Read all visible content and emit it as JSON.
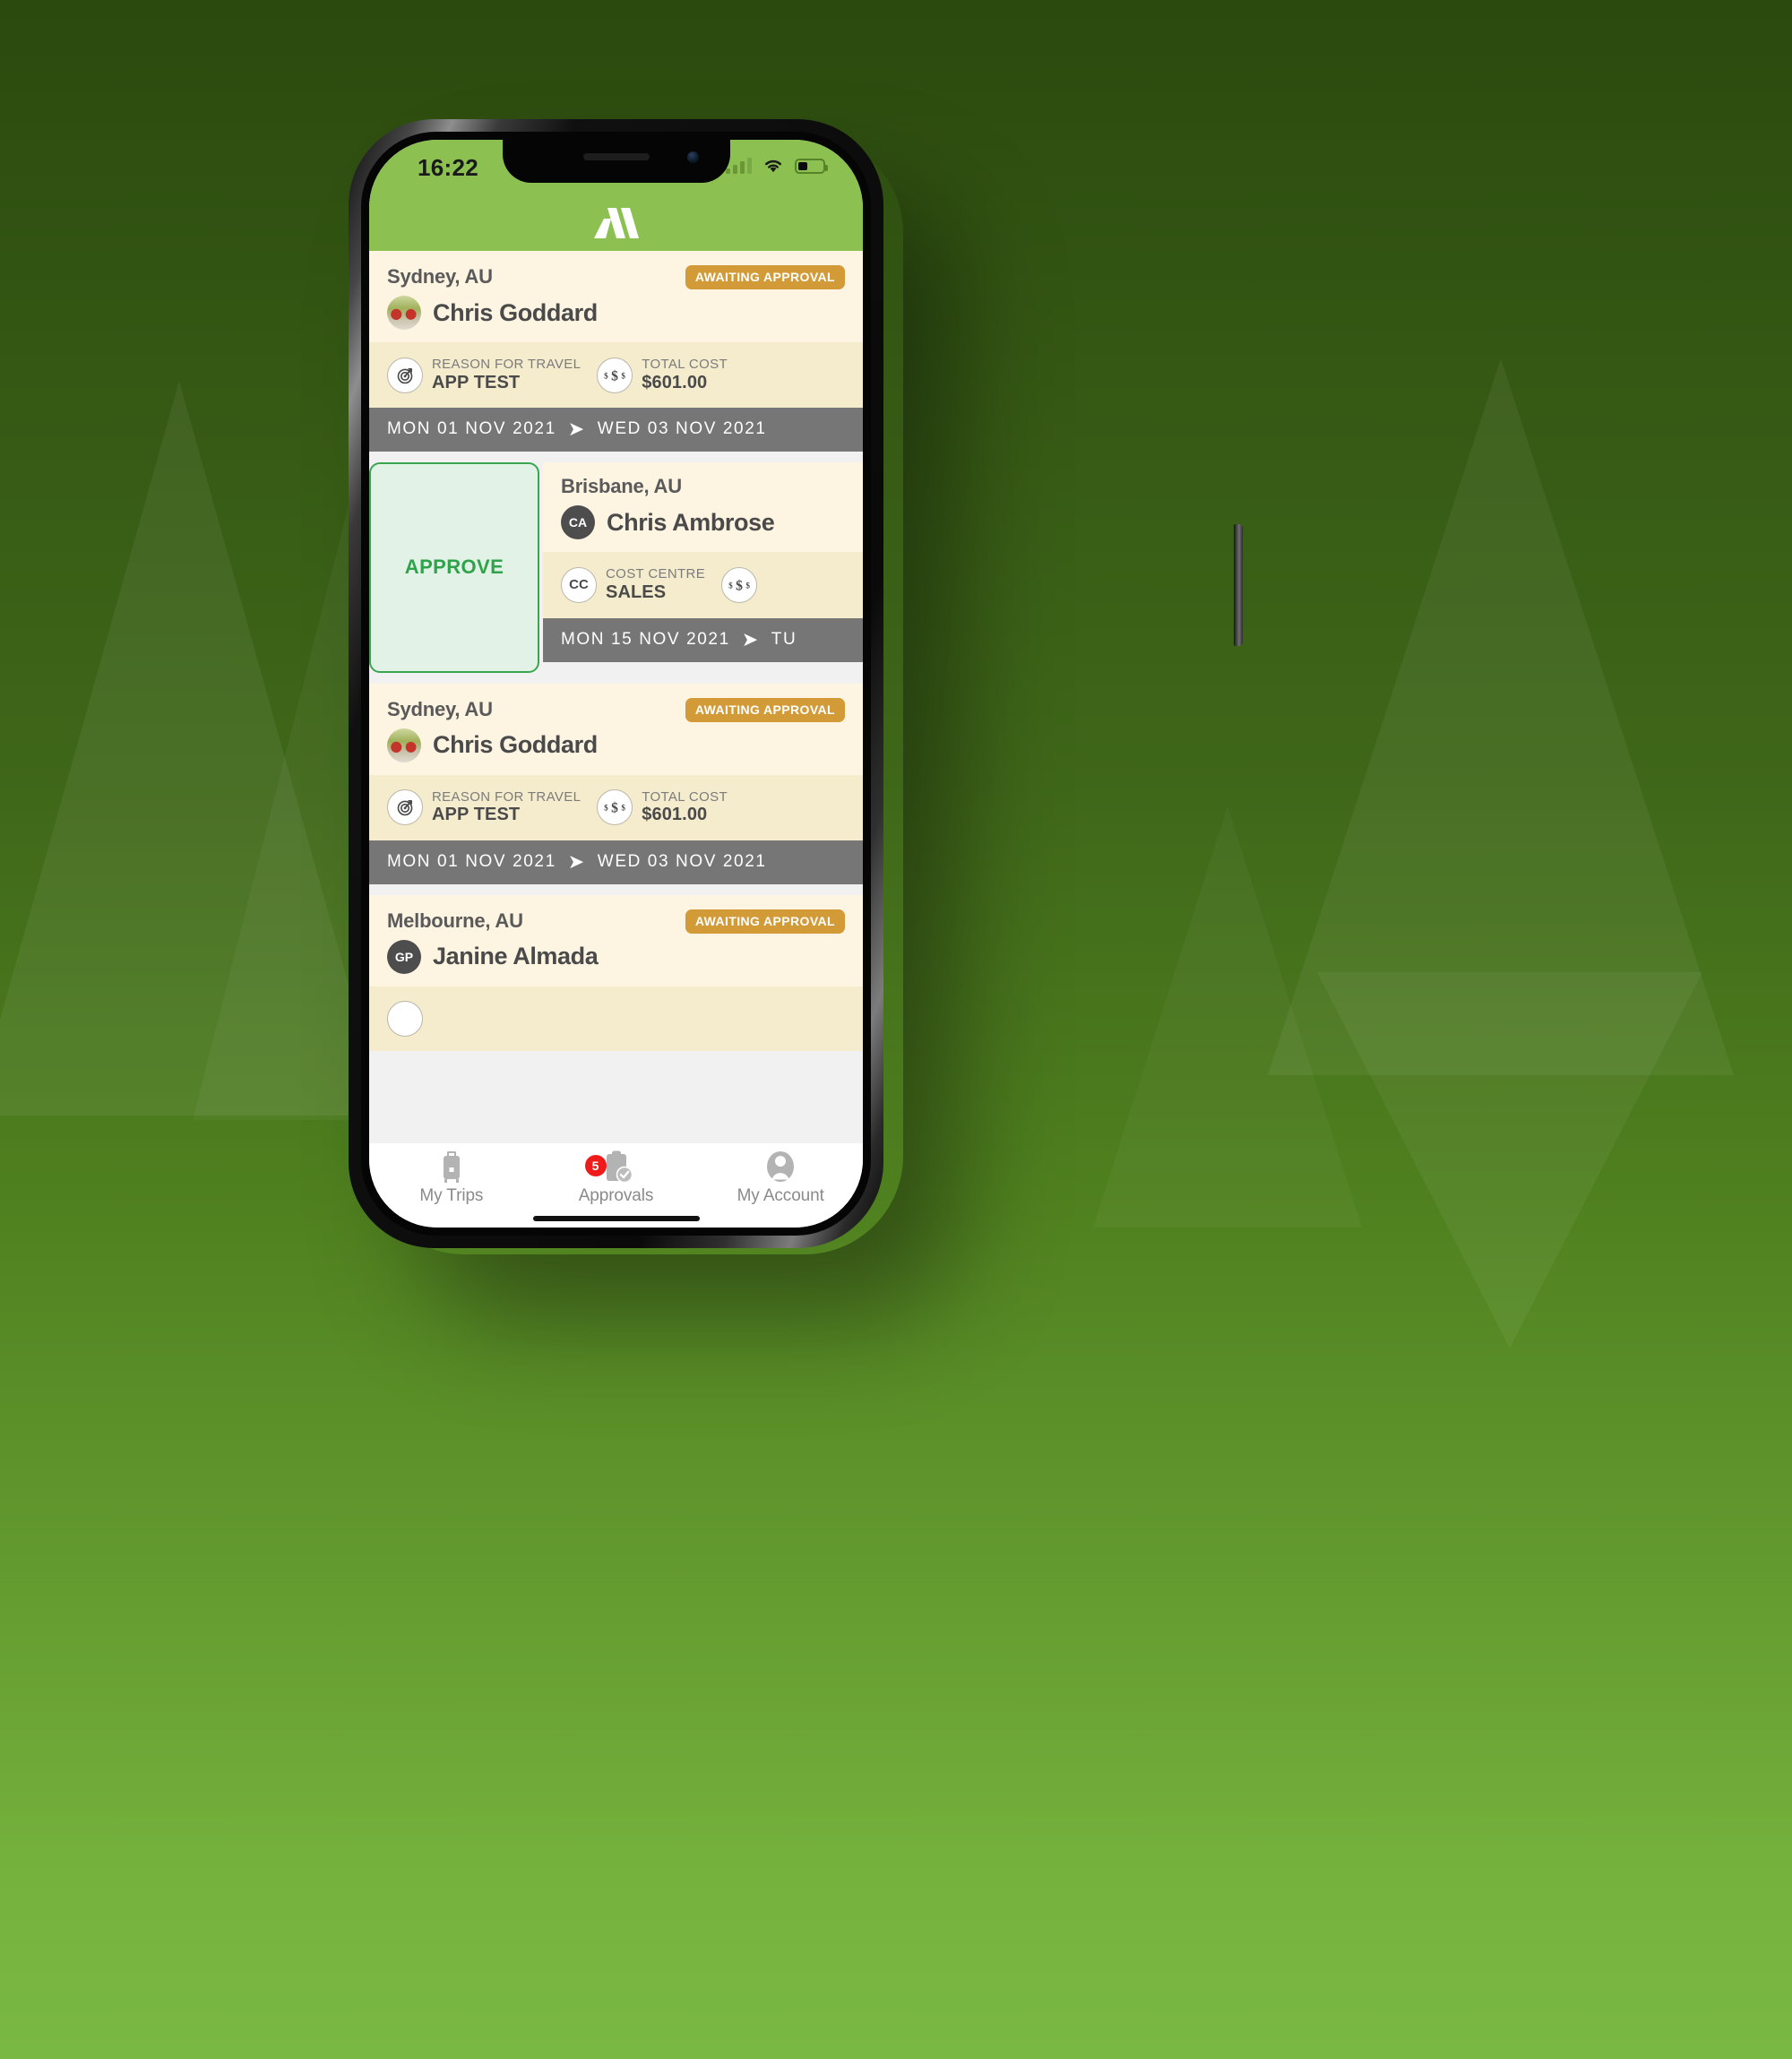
{
  "status_bar": {
    "time": "16:22",
    "signal_icon": "cellular-signal-icon",
    "wifi_icon": "wifi-icon",
    "battery_icon": "battery-icon",
    "battery_level_pct": 40
  },
  "app_header": {
    "logo_name": "app-logo-m",
    "brand_green": "#8cc152"
  },
  "colors": {
    "brand_green": "#8cc152",
    "card_cream": "#fdf4e2",
    "detail_cream": "#f5ecce",
    "date_grey": "#767676",
    "badge_gold": "#d29b37",
    "approve_green": "#3aa551",
    "approve_bg": "#e3f2e6",
    "badge_red": "#ef1b1b"
  },
  "approve_action": {
    "label": "APPROVE"
  },
  "cards": [
    {
      "city": "Sydney, AU",
      "status": "AWAITING APPROVAL",
      "traveller": "Chris Goddard",
      "avatar_type": "photo",
      "avatar_initials": "",
      "details": [
        {
          "icon": "target-icon",
          "icon_text": "",
          "label": "REASON FOR TRAVEL",
          "value": "APP TEST"
        },
        {
          "icon": "dollar-icon",
          "icon_text": "",
          "label": "TOTAL COST",
          "value": "$601.00"
        }
      ],
      "date_start": "MON 01 NOV 2021",
      "date_end": "WED 03 NOV 2021",
      "swiped": false
    },
    {
      "city": "Brisbane, AU",
      "status": "",
      "traveller": "Chris Ambrose",
      "avatar_type": "initials",
      "avatar_initials": "CA",
      "details": [
        {
          "icon": "cost-centre-icon",
          "icon_text": "CC",
          "label": "COST CENTRE",
          "value": "SALES"
        },
        {
          "icon": "dollar-icon",
          "icon_text": "",
          "label": "",
          "value": ""
        }
      ],
      "date_start": "MON 15 NOV 2021",
      "date_end": "TU",
      "swiped": true
    },
    {
      "city": "Sydney, AU",
      "status": "AWAITING APPROVAL",
      "traveller": "Chris Goddard",
      "avatar_type": "photo",
      "avatar_initials": "",
      "details": [
        {
          "icon": "target-icon",
          "icon_text": "",
          "label": "REASON FOR TRAVEL",
          "value": "APP TEST"
        },
        {
          "icon": "dollar-icon",
          "icon_text": "",
          "label": "TOTAL COST",
          "value": "$601.00"
        }
      ],
      "date_start": "MON 01 NOV 2021",
      "date_end": "WED 03 NOV 2021",
      "swiped": false
    },
    {
      "city": "Melbourne, AU",
      "status": "AWAITING APPROVAL",
      "traveller": "Janine Almada",
      "avatar_type": "initials",
      "avatar_initials": "GP",
      "details": [],
      "date_start": "",
      "date_end": "",
      "swiped": false
    }
  ],
  "tabbar": {
    "items": [
      {
        "label": "My Trips",
        "icon": "suitcase-icon",
        "badge": ""
      },
      {
        "label": "Approvals",
        "icon": "clipboard-check-icon",
        "badge": "5"
      },
      {
        "label": "My Account",
        "icon": "person-icon",
        "badge": ""
      }
    ]
  }
}
